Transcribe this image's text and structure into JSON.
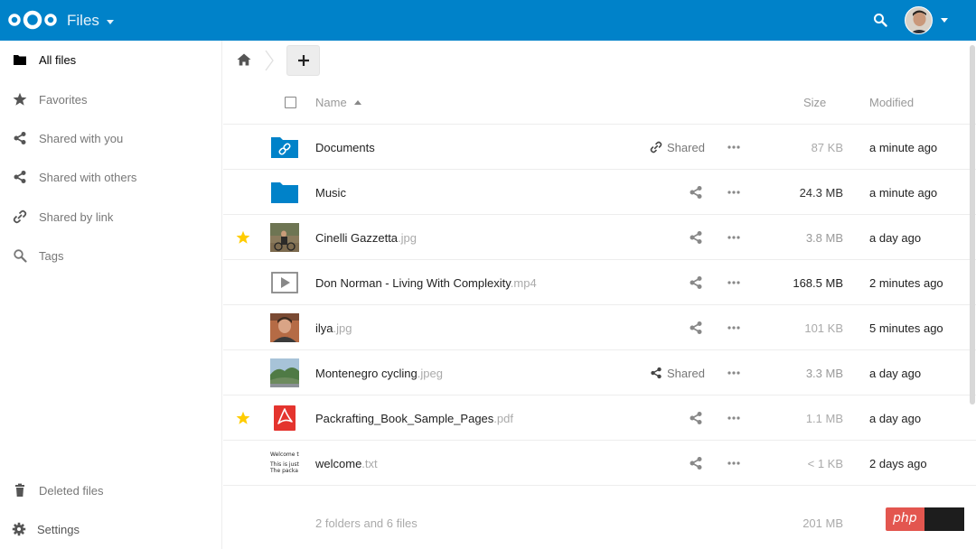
{
  "header": {
    "app_name": "Files",
    "logo_icon": "nextcloud-logo",
    "brand_color": "#0082c9"
  },
  "sidebar": {
    "items": [
      {
        "label": "All files",
        "icon": "folder-icon",
        "active": true
      },
      {
        "label": "Favorites",
        "icon": "star-icon"
      },
      {
        "label": "Shared with you",
        "icon": "share-icon"
      },
      {
        "label": "Shared with others",
        "icon": "share-icon"
      },
      {
        "label": "Shared by link",
        "icon": "link-icon"
      },
      {
        "label": "Tags",
        "icon": "tag-search-icon"
      }
    ],
    "bottom": [
      {
        "label": "Deleted files",
        "icon": "trash-icon"
      },
      {
        "label": "Settings",
        "icon": "gear-icon"
      }
    ]
  },
  "toolbar": {
    "new_label": "+"
  },
  "table": {
    "headers": {
      "name": "Name",
      "size": "Size",
      "modified": "Modified"
    },
    "rows": [
      {
        "name": "Documents",
        "ext": "",
        "type": "shared-folder",
        "favorite": false,
        "share": "Shared",
        "share_icon": "link-icon",
        "size": "87 KB",
        "size_color": "#aaaaaa",
        "modified": "a minute ago"
      },
      {
        "name": "Music",
        "ext": "",
        "type": "folder",
        "favorite": false,
        "share": "",
        "share_icon": "share-icon",
        "size": "24.3 MB",
        "size_color": "#333333",
        "modified": "a minute ago"
      },
      {
        "name": "Cinelli Gazzetta",
        "ext": ".jpg",
        "type": "image-cyclist",
        "favorite": true,
        "share": "",
        "share_icon": "share-icon",
        "size": "3.8 MB",
        "size_color": "#999999",
        "modified": "a day ago"
      },
      {
        "name": "Don Norman - Living With Complexity",
        "ext": ".mp4",
        "type": "video",
        "favorite": false,
        "share": "",
        "share_icon": "share-icon",
        "size": "168.5 MB",
        "size_color": "#222222",
        "modified": "2 minutes ago"
      },
      {
        "name": "ilya",
        "ext": ".jpg",
        "type": "image-portrait",
        "favorite": false,
        "share": "",
        "share_icon": "share-icon",
        "size": "101 KB",
        "size_color": "#aaaaaa",
        "modified": "5 minutes ago"
      },
      {
        "name": "Montenegro cycling",
        "ext": ".jpeg",
        "type": "image-landscape",
        "favorite": false,
        "share": "Shared",
        "share_icon": "share-icon",
        "size": "3.3 MB",
        "size_color": "#999999",
        "modified": "a day ago"
      },
      {
        "name": "Packrafting_Book_Sample_Pages",
        "ext": ".pdf",
        "type": "pdf",
        "favorite": true,
        "share": "",
        "share_icon": "share-icon",
        "size": "1.1 MB",
        "size_color": "#aaaaaa",
        "modified": "a day ago"
      },
      {
        "name": "welcome",
        "ext": ".txt",
        "type": "text",
        "favorite": false,
        "share": "",
        "share_icon": "share-icon",
        "size": "< 1 KB",
        "size_color": "#aaaaaa",
        "modified": "2 days ago"
      }
    ],
    "text_preview": [
      "Welcome t",
      "This is just",
      "The packa"
    ]
  },
  "summary": {
    "count": "2 folders and 6 files",
    "total": "201 MB"
  },
  "watermark": {
    "text": "php"
  }
}
